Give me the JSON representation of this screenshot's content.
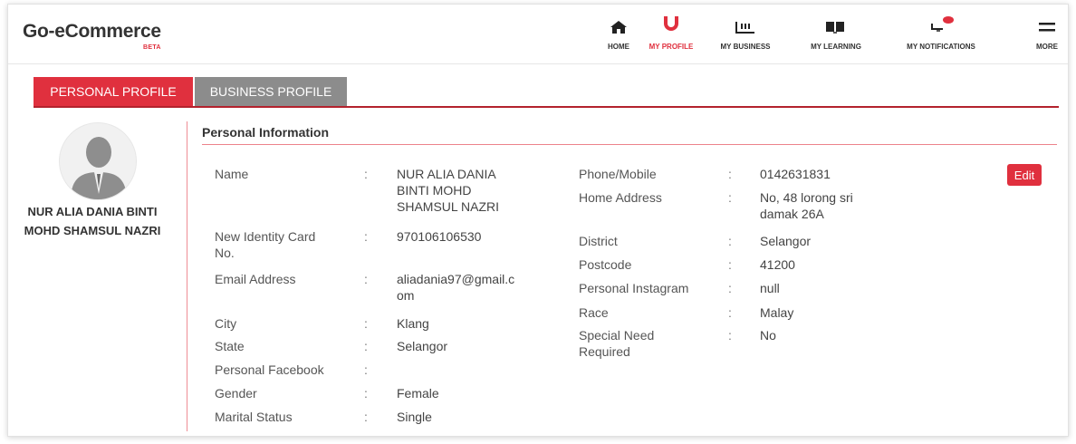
{
  "brand": {
    "name": "Go-eCommerce",
    "beta": "BETA"
  },
  "nav": {
    "home": "HOME",
    "my_profile": "MY PROFILE",
    "my_business": "MY BUSINESS",
    "my_learning": "MY LEARNING",
    "my_notifications": "MY NOTIFICATIONS",
    "more": "MORE"
  },
  "tabs": {
    "personal": "PERSONAL PROFILE",
    "business": "BUSINESS PROFILE"
  },
  "profile": {
    "name_line1": "NUR ALIA DANIA BINTI",
    "name_line2": "MOHD SHAMSUL NAZRI"
  },
  "section_title": "Personal Information",
  "edit_label": "Edit",
  "colon": ":",
  "left_fields": [
    {
      "label": "Name",
      "value_lines": [
        "NUR ALIA DANIA",
        "BINTI MOHD",
        "SHAMSUL NAZRI"
      ]
    },
    {
      "label_lines": [
        "New Identity Card",
        "No."
      ],
      "value": "970106106530"
    },
    {
      "label": "Email Address",
      "value_lines": [
        "aliadania97@gmail.c",
        "om"
      ]
    },
    {
      "label": "City",
      "value": "Klang"
    },
    {
      "label": "State",
      "value": "Selangor"
    },
    {
      "label": "Personal Facebook",
      "value": ""
    },
    {
      "label": "Gender",
      "value": "Female"
    },
    {
      "label": "Marital Status",
      "value": "Single"
    }
  ],
  "right_fields": [
    {
      "label": "Phone/Mobile",
      "value": "0142631831"
    },
    {
      "label": "Home Address",
      "value_lines": [
        "No, 48 lorong sri",
        "damak 26A"
      ]
    },
    {
      "label": "District",
      "value": "Selangor"
    },
    {
      "label": "Postcode",
      "value": "41200"
    },
    {
      "label": "Personal Instagram",
      "value": "null"
    },
    {
      "label": "Race",
      "value": "Malay"
    },
    {
      "label_lines": [
        "Special Need",
        "Required"
      ],
      "value": "No"
    }
  ]
}
